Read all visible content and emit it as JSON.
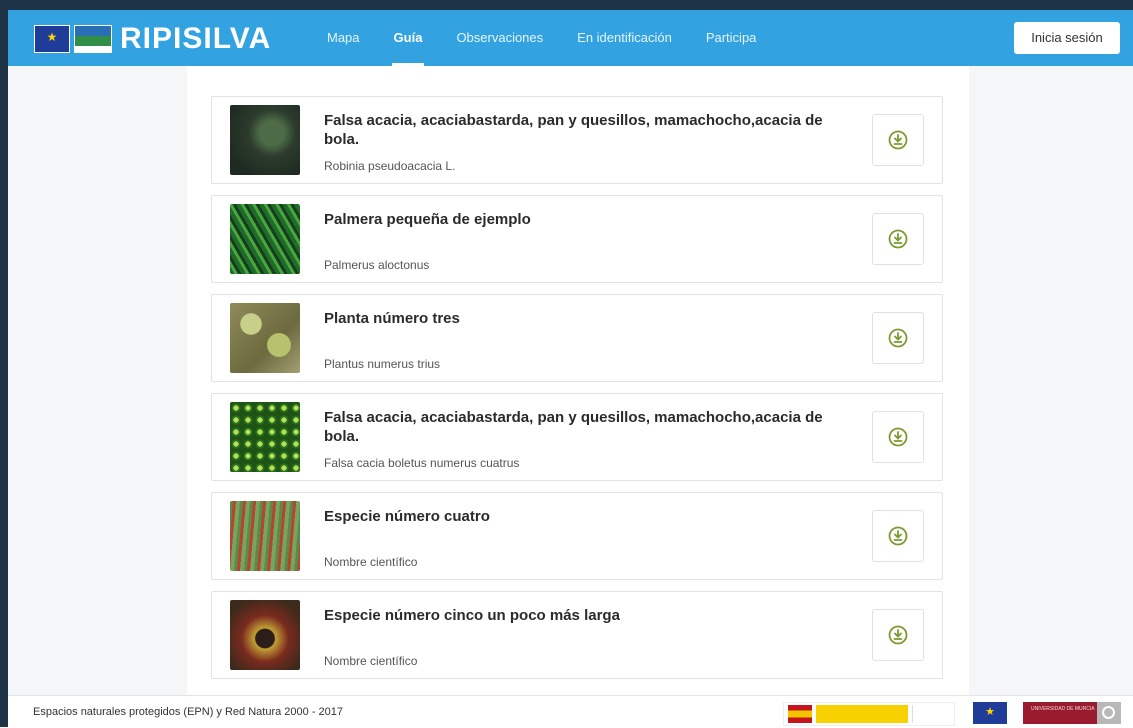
{
  "header": {
    "logo_text": "RIPISILVA",
    "nav": [
      {
        "label": "Mapa",
        "active": false
      },
      {
        "label": "Guía",
        "active": true
      },
      {
        "label": "Observaciones",
        "active": false
      },
      {
        "label": "En identificación",
        "active": false
      },
      {
        "label": "Participa",
        "active": false
      }
    ],
    "login_label": "Inicia sesión"
  },
  "species": [
    {
      "title": "Falsa acacia, acaciabastarda, pan y quesillos, mamachocho,acacia de bola.",
      "scientific": "Robinia pseudoacacia L.",
      "image_icon": "tree-photo"
    },
    {
      "title": "Palmera pequeña de ejemplo",
      "scientific": "Palmerus aloctonus",
      "image_icon": "fern-photo"
    },
    {
      "title": "Planta número tres",
      "scientific": "Plantus numerus trius",
      "image_icon": "moss-photo"
    },
    {
      "title": "Falsa acacia, acaciabastarda, pan y quesillos, mamachocho,acacia de bola.",
      "scientific": "Falsa cacia boletus numerus cuatrus",
      "image_icon": "duckweed-photo"
    },
    {
      "title": "Especie número cuatro",
      "scientific": "Nombre científico",
      "image_icon": "sundew-photo"
    },
    {
      "title": "Especie número cinco un poco más larga",
      "scientific": "Nombre científico",
      "image_icon": "carnivorous-plant-photo"
    }
  ],
  "footer": {
    "text": "Espacios naturales protegidos (EPN) y Red Natura 2000 - 2017",
    "umu_label": "UNIVERSIDAD DE MURCIA"
  },
  "colors": {
    "topbar": "#32a3e0",
    "download_icon": "#7a9a2e"
  }
}
